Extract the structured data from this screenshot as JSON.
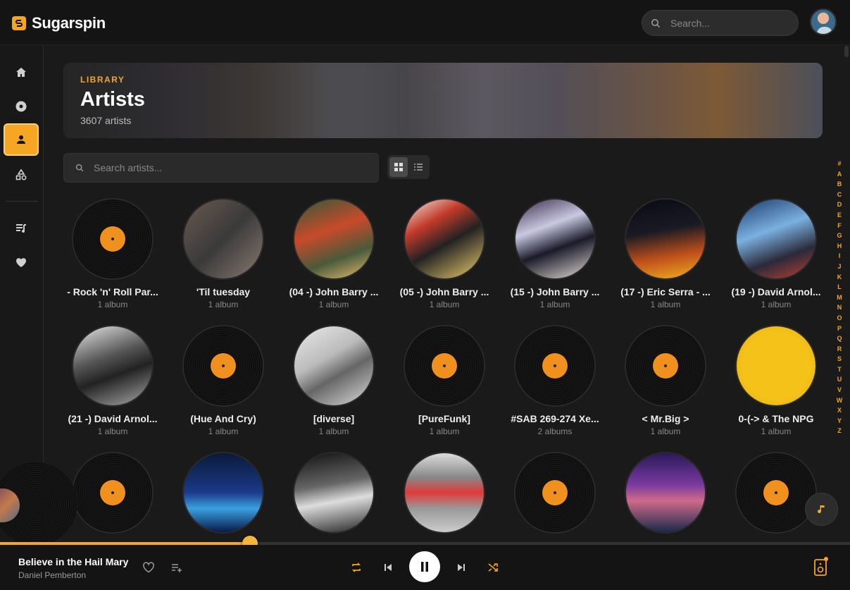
{
  "app": {
    "name": "Sugarspin"
  },
  "topbar": {
    "search_placeholder": "Search..."
  },
  "sidebar": {
    "items": [
      {
        "name": "home",
        "icon": "home-icon"
      },
      {
        "name": "albums",
        "icon": "disc-icon"
      },
      {
        "name": "artists",
        "icon": "person-icon",
        "active": true
      },
      {
        "name": "genres",
        "icon": "shapes-icon"
      },
      {
        "name": "playlists",
        "icon": "playlist-icon"
      },
      {
        "name": "favorites",
        "icon": "heart-icon"
      }
    ]
  },
  "hero": {
    "label": "LIBRARY",
    "title": "Artists",
    "subtitle": "3607 artists"
  },
  "filter": {
    "search_placeholder": "Search artists..."
  },
  "artists": [
    {
      "name": "- Rock 'n' Roll Par...",
      "count": "1 album",
      "art": "vinyl"
    },
    {
      "name": "'Til tuesday",
      "count": "1 album",
      "art": "photo"
    },
    {
      "name": "(04 -) John Barry ...",
      "count": "1 album",
      "art": "photo"
    },
    {
      "name": "(05 -) John Barry ...",
      "count": "1 album",
      "art": "photo"
    },
    {
      "name": "(15 -) John Barry ...",
      "count": "1 album",
      "art": "photo"
    },
    {
      "name": "(17 -) Eric Serra - ...",
      "count": "1 album",
      "art": "photo"
    },
    {
      "name": "(19 -) David Arnol...",
      "count": "1 album",
      "art": "photo"
    },
    {
      "name": "(21 -) David Arnol...",
      "count": "1 album",
      "art": "photo"
    },
    {
      "name": "(Hue And Cry)",
      "count": "1 album",
      "art": "vinyl"
    },
    {
      "name": "[diverse]",
      "count": "1 album",
      "art": "photo"
    },
    {
      "name": "[PureFunk]",
      "count": "1 album",
      "art": "vinyl"
    },
    {
      "name": "#SAB 269-274 Xe...",
      "count": "2 albums",
      "art": "vinyl"
    },
    {
      "name": "< Mr.Big >",
      "count": "1 album",
      "art": "vinyl"
    },
    {
      "name": "0-(-> & The NPG",
      "count": "1 album",
      "art": "photo"
    },
    {
      "name": "",
      "count": "",
      "art": "vinyl"
    },
    {
      "name": "",
      "count": "",
      "art": "photo"
    },
    {
      "name": "",
      "count": "",
      "art": "photo"
    },
    {
      "name": "",
      "count": "",
      "art": "photo"
    },
    {
      "name": "",
      "count": "",
      "art": "vinyl"
    },
    {
      "name": "",
      "count": "",
      "art": "photo"
    },
    {
      "name": "",
      "count": "",
      "art": "vinyl"
    }
  ],
  "alphabet": [
    "#",
    "A",
    "B",
    "C",
    "D",
    "E",
    "F",
    "G",
    "H",
    "I",
    "J",
    "K",
    "L",
    "M",
    "N",
    "O",
    "P",
    "Q",
    "R",
    "S",
    "T",
    "U",
    "V",
    "W",
    "X",
    "Y",
    "Z"
  ],
  "player": {
    "title": "Believe in the Hail Mary",
    "artist": "Daniel Pemberton",
    "progress": 0.29
  },
  "colors": {
    "accent": "#f5a623",
    "background": "#1a1a1a"
  }
}
